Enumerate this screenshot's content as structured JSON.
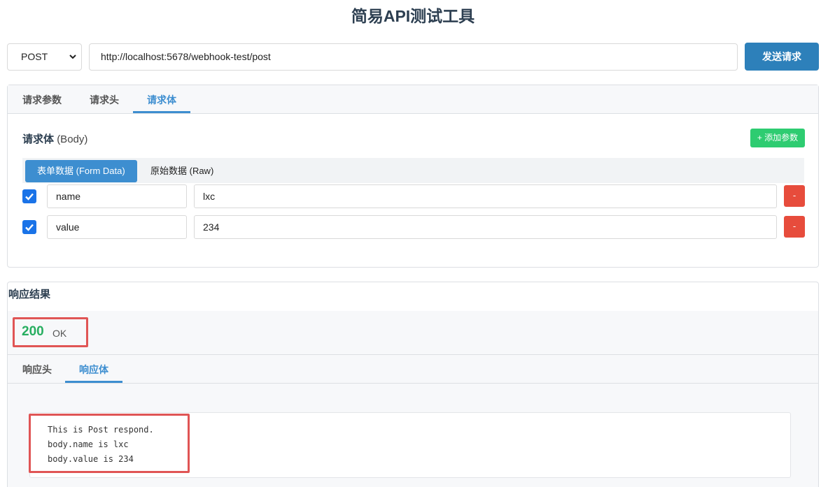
{
  "app": {
    "title": "简易API测试工具"
  },
  "request": {
    "method": "POST",
    "url": "http://localhost:5678/webhook-test/post",
    "send_label": "发送请求",
    "tabs": [
      {
        "label": "请求参数",
        "active": false
      },
      {
        "label": "请求头",
        "active": false
      },
      {
        "label": "请求体",
        "active": true
      }
    ],
    "body": {
      "title": "请求体",
      "title_sub": "(Body)",
      "add_label": "+ 添加参数",
      "types": [
        {
          "label": "表单数据 (Form Data)",
          "active": true
        },
        {
          "label": "原始数据 (Raw)",
          "active": false
        }
      ],
      "params": [
        {
          "checked": true,
          "key": "name",
          "value": "lxc",
          "remove_label": "-"
        },
        {
          "checked": true,
          "key": "value",
          "value": "234",
          "remove_label": "-"
        }
      ]
    }
  },
  "response": {
    "title": "响应结果",
    "status_code": "200",
    "status_text": "OK",
    "tabs": [
      {
        "label": "响应头",
        "active": false
      },
      {
        "label": "响应体",
        "active": true
      }
    ],
    "body_lines": [
      "This is Post respond.",
      "body.name is lxc",
      "body.value is 234"
    ]
  },
  "colors": {
    "primary": "#2d80ba",
    "tab_active": "#3d8ed0",
    "success": "#2ecc71",
    "danger": "#e74c3c",
    "status_ok": "#27ae60",
    "highlight": "#e05555"
  }
}
